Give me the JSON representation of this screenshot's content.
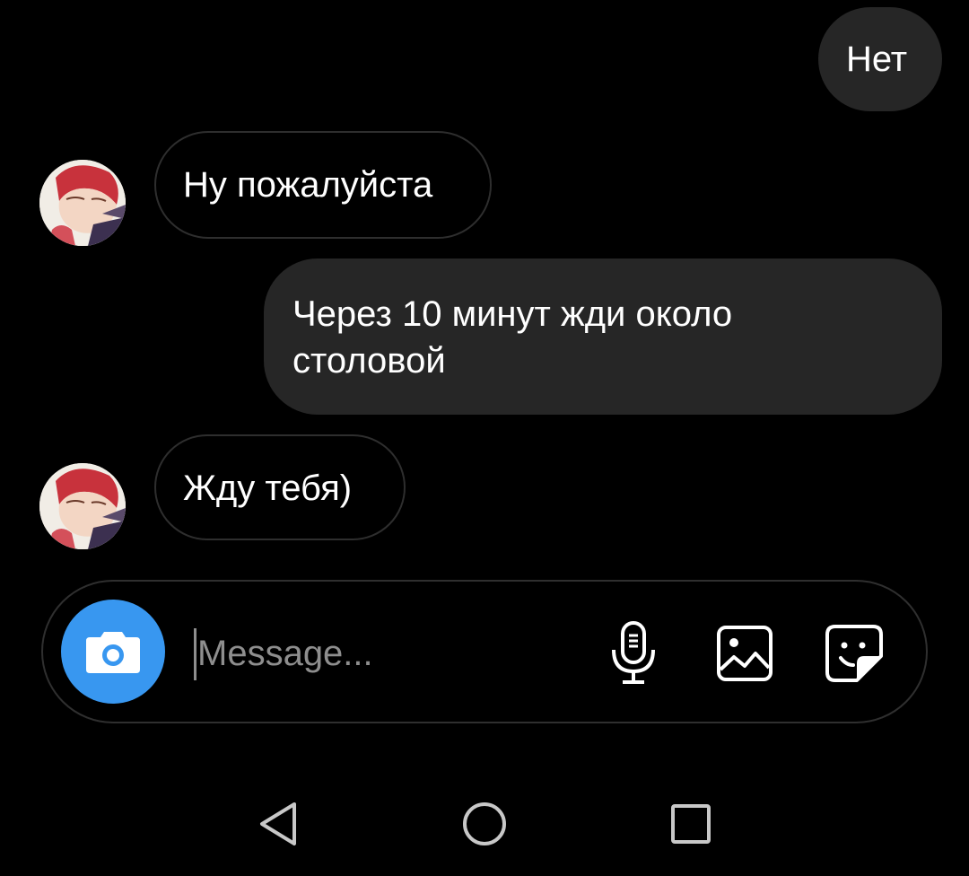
{
  "conversation": {
    "messages": [
      {
        "direction": "outgoing",
        "text": "Нет"
      },
      {
        "direction": "incoming",
        "text": "Ну пожалуйста"
      },
      {
        "direction": "outgoing",
        "text": "Через 10 минут жди около столовой",
        "lines": [
          "Через 10 минут жди около",
          "столовой"
        ]
      },
      {
        "direction": "incoming",
        "text": "Жду тебя)"
      }
    ]
  },
  "composer": {
    "placeholder": "Message...",
    "camera_icon": "camera-icon",
    "mic_icon": "microphone-icon",
    "gallery_icon": "gallery-icon",
    "sticker_icon": "sticker-icon",
    "accent_color": "#3897f0"
  },
  "navbar": {
    "back_icon": "back-triangle-icon",
    "home_icon": "home-circle-icon",
    "recents_icon": "recents-square-icon"
  },
  "colors": {
    "background": "#000000",
    "outgoing_bubble": "#262626",
    "incoming_border": "#2e2e2e",
    "text": "#ffffff",
    "placeholder": "#8e8e8e"
  }
}
